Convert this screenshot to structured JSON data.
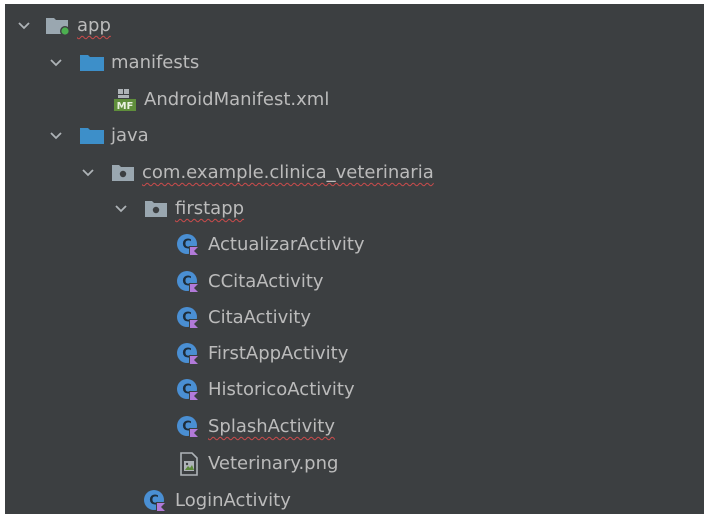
{
  "colors": {
    "panel_bg": "#3c3f41",
    "text": "#bbbbbb",
    "folder_blue": "#3d8fc9",
    "folder_gray": "#9aa7b0",
    "kotlin_blue": "#4a8fd3",
    "kotlin_purple": "#b27ad9",
    "spell_underline": "#cc4b4b"
  },
  "tree": {
    "app": {
      "label": "app",
      "icon": "module-folder-icon",
      "expanded": true
    },
    "manifests": {
      "label": "manifests",
      "icon": "folder-icon",
      "expanded": true
    },
    "android_manifest": {
      "label": "AndroidManifest.xml",
      "icon": "manifest-file-icon",
      "badge": "MF"
    },
    "java": {
      "label": "java",
      "icon": "folder-icon",
      "expanded": true
    },
    "package": {
      "label": "com.example.clinica_veterinaria",
      "icon": "package-icon",
      "expanded": true
    },
    "firstapp": {
      "label": "firstapp",
      "icon": "package-icon",
      "expanded": true
    },
    "files": [
      {
        "label": "ActualizarActivity",
        "icon": "kotlin-class-icon"
      },
      {
        "label": "CCitaActivity",
        "icon": "kotlin-class-icon"
      },
      {
        "label": "CitaActivity",
        "icon": "kotlin-class-icon"
      },
      {
        "label": "FirstAppActivity",
        "icon": "kotlin-class-icon"
      },
      {
        "label": "HistoricoActivity",
        "icon": "kotlin-class-icon"
      },
      {
        "label": "SplashActivity",
        "icon": "kotlin-class-icon"
      },
      {
        "label": "Veterinary.png",
        "icon": "image-file-icon"
      }
    ],
    "login_activity": {
      "label": "LoginActivity",
      "icon": "kotlin-class-icon"
    }
  }
}
